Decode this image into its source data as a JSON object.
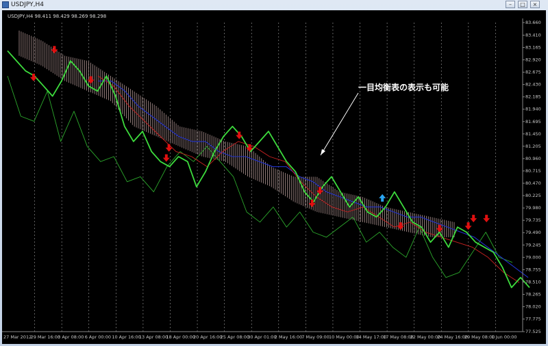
{
  "window": {
    "title": "USDJPY,H4",
    "icon": "chart-icon",
    "buttons": {
      "minimize": "–",
      "maximize": "□",
      "close": "×"
    }
  },
  "chart_header": "USDJPY,H4  98.411 98.429 98.269 98.298",
  "annotation": "一目均衡表の表示も可能",
  "colors": {
    "background": "#000000",
    "price": "#3ddc3d",
    "chikou": "#2ca82c",
    "kijun": "#2233cc",
    "tenkan": "#cc2222",
    "kumo": "#c8aaa8",
    "grid": "#a0a0a0",
    "axis_text": "#c8c8c8",
    "sell_arrow": "#e01010",
    "buy_arrow": "#2aa4f0"
  },
  "chart_data": {
    "type": "line",
    "price_axis": [
      "83.660",
      "83.410",
      "83.165",
      "82.920",
      "82.675",
      "82.430",
      "82.185",
      "81.940",
      "81.695",
      "81.450",
      "81.205",
      "80.960",
      "80.715",
      "80.470",
      "80.225",
      "79.980",
      "79.735",
      "79.490",
      "79.245",
      "79.000",
      "78.755",
      "78.510",
      "78.265",
      "78.020",
      "77.775",
      "77.525"
    ],
    "time_axis": [
      "27 Mar 2012",
      "29 Mar 16:00",
      "3 Apr 08:00",
      "6 Apr 00:00",
      "10 Apr 16:00",
      "13 Apr 08:00",
      "18 Apr 00:00",
      "20 Apr 16:00",
      "25 Apr 08:00",
      "30 Apr 01:00",
      "2 May 16:00",
      "7 May 09:00",
      "10 May 00:00",
      "14 May 17:00",
      "17 May 08:00",
      "22 May 00:00",
      "24 May 16:00",
      "29 May 08:00",
      "1 Jun 00:00"
    ],
    "ylim": [
      77.525,
      83.66
    ],
    "series": [
      {
        "key": "price",
        "values": [
          83.1,
          82.9,
          82.7,
          82.6,
          82.4,
          82.2,
          82.5,
          82.9,
          82.7,
          82.4,
          82.3,
          82.6,
          82.2,
          81.6,
          81.3,
          81.5,
          81.1,
          80.9,
          80.8,
          81.0,
          80.9,
          80.4,
          80.7,
          81.1,
          81.4,
          81.6,
          81.4,
          81.1,
          81.3,
          81.5,
          81.2,
          80.9,
          80.7,
          80.3,
          80.1,
          80.4,
          80.6,
          80.3,
          80.0,
          80.2,
          79.9,
          79.8,
          80.0,
          80.3,
          80.0,
          79.7,
          79.6,
          79.3,
          79.5,
          79.2,
          79.6,
          79.5,
          79.3,
          79.2,
          79.1,
          78.8,
          78.4,
          78.6,
          78.4
        ]
      },
      {
        "key": "chikou",
        "values": [
          82.6,
          81.8,
          81.7,
          82.3,
          81.3,
          81.9,
          81.2,
          80.9,
          81.0,
          80.5,
          80.6,
          80.3,
          80.8,
          81.1,
          80.9,
          81.2,
          80.9,
          80.6,
          79.9,
          79.7,
          80.0,
          79.6,
          79.9,
          79.5,
          79.4,
          79.6,
          79.8,
          79.3,
          79.5,
          79.2,
          79.0,
          79.6,
          79.0,
          78.6,
          78.7,
          79.1,
          79.5,
          79.0,
          78.9
        ]
      },
      {
        "key": "kijun",
        "values": [
          82.5,
          82.5,
          82.3,
          82.0,
          81.8,
          81.6,
          81.4,
          81.3,
          81.3,
          81.1,
          81.0,
          81.0,
          80.9,
          80.8,
          80.8,
          80.6,
          80.5,
          80.3,
          80.2,
          80.1,
          80.0,
          80.0,
          79.9,
          79.8,
          79.8,
          79.7,
          79.6,
          79.5,
          79.4,
          79.2,
          79.0,
          78.8,
          78.6
        ]
      },
      {
        "key": "tenkan",
        "values": [
          82.6,
          82.4,
          82.0,
          81.7,
          81.4,
          81.1,
          81.0,
          80.8,
          81.1,
          81.3,
          81.2,
          81.0,
          80.9,
          80.5,
          80.2,
          80.0,
          79.9,
          80.0,
          79.8,
          79.6,
          79.7,
          79.5,
          79.4,
          79.3,
          79.2,
          79.0,
          78.7,
          78.5
        ]
      }
    ],
    "kumo": {
      "upper": [
        83.5,
        83.3,
        83.0,
        82.9,
        82.6,
        82.3,
        82.0,
        81.6,
        81.5,
        81.3,
        81.2,
        80.8,
        80.6,
        80.6,
        80.3,
        80.2,
        80.0,
        79.9,
        79.8,
        79.7
      ],
      "lower": [
        83.0,
        82.8,
        82.5,
        82.3,
        82.1,
        81.6,
        81.4,
        81.2,
        81.0,
        80.9,
        80.6,
        80.4,
        80.1,
        79.9,
        79.8,
        79.7,
        79.6,
        79.5,
        79.4,
        79.4
      ]
    },
    "arrows": [
      {
        "type": "sell",
        "t": 0.05,
        "price": 82.55
      },
      {
        "type": "sell",
        "t": 0.09,
        "price": 83.1
      },
      {
        "type": "sell",
        "t": 0.16,
        "price": 82.5
      },
      {
        "type": "sell",
        "t": 0.31,
        "price": 81.15
      },
      {
        "type": "sell",
        "t": 0.305,
        "price": 80.95
      },
      {
        "type": "sell",
        "t": 0.445,
        "price": 81.4
      },
      {
        "type": "sell",
        "t": 0.465,
        "price": 81.15
      },
      {
        "type": "sell",
        "t": 0.585,
        "price": 80.05
      },
      {
        "type": "sell",
        "t": 0.6,
        "price": 80.3
      },
      {
        "type": "buy",
        "t": 0.72,
        "price": 80.2
      },
      {
        "type": "sell",
        "t": 0.755,
        "price": 79.6
      },
      {
        "type": "sell",
        "t": 0.83,
        "price": 79.55
      },
      {
        "type": "sell",
        "t": 0.885,
        "price": 79.6
      },
      {
        "type": "sell",
        "t": 0.895,
        "price": 79.75
      },
      {
        "type": "sell",
        "t": 0.92,
        "price": 79.75
      }
    ]
  }
}
